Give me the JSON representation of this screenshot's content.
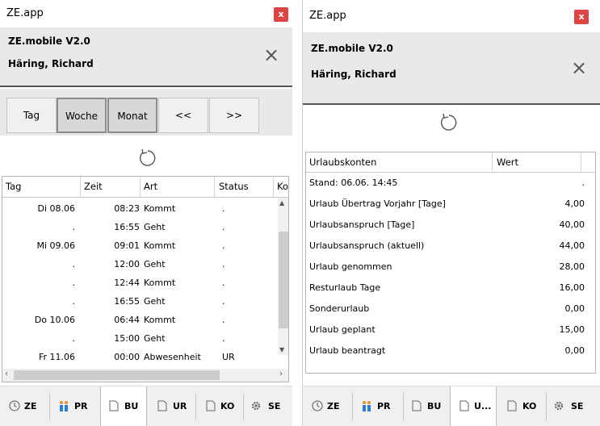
{
  "left": {
    "window_title": "ZE.app",
    "close_label": "x",
    "app_name": "ZE.mobile V2.0",
    "user_name": "Häring, Richard",
    "header_close": "×",
    "toolbar": [
      {
        "label": "Tag",
        "active": false
      },
      {
        "label": "Woche",
        "active": true
      },
      {
        "label": "Monat",
        "active": true
      },
      {
        "label": "<<",
        "active": false
      },
      {
        "label": ">>",
        "active": false
      }
    ],
    "grid": {
      "columns": [
        "Tag",
        "Zeit",
        "Art",
        "Status",
        "Ko"
      ],
      "rows": [
        {
          "tag": "Di 08.06",
          "zeit": "08:23",
          "art": "Kommt",
          "status": "."
        },
        {
          "tag": ".",
          "zeit": "16:55",
          "art": "Geht",
          "status": "."
        },
        {
          "tag": "Mi 09.06",
          "zeit": "09:01",
          "art": "Kommt",
          "status": "."
        },
        {
          "tag": ".",
          "zeit": "12:00",
          "art": "Geht",
          "status": "."
        },
        {
          "tag": ".",
          "zeit": "12:44",
          "art": "Kommt",
          "status": "."
        },
        {
          "tag": ".",
          "zeit": "16:55",
          "art": "Geht",
          "status": "."
        },
        {
          "tag": "Do 10.06",
          "zeit": "06:44",
          "art": "Kommt",
          "status": "."
        },
        {
          "tag": ".",
          "zeit": "15:00",
          "art": "Geht",
          "status": "."
        },
        {
          "tag": "Fr 11.06",
          "zeit": "00:00",
          "art": "Abwesenheit",
          "status": "UR"
        }
      ]
    },
    "nav": [
      {
        "label": "ZE",
        "icon": "clock-icon",
        "active": false
      },
      {
        "label": "PR",
        "icon": "people-icon",
        "active": false
      },
      {
        "label": "BU",
        "icon": "document-icon",
        "active": true
      },
      {
        "label": "UR",
        "icon": "document-icon",
        "active": false
      },
      {
        "label": "KO",
        "icon": "document-icon",
        "active": false
      },
      {
        "label": "SE",
        "icon": "gear-icon",
        "active": false
      }
    ]
  },
  "right": {
    "window_title": "ZE.app",
    "close_label": "x",
    "app_name": "ZE.mobile V2.0",
    "user_name": "Häring, Richard",
    "header_close": "×",
    "table": {
      "columns": [
        "Urlaubskonten",
        "Wert"
      ],
      "rows": [
        {
          "label": "Stand: 06.06. 14:45",
          "value": "."
        },
        {
          "label": "Urlaub Übertrag Vorjahr [Tage]",
          "value": "4,00"
        },
        {
          "label": "Urlaubsanspruch [Tage]",
          "value": "40,00"
        },
        {
          "label": "Urlaubsanspruch (aktuell)",
          "value": "44,00"
        },
        {
          "label": "Urlaub genommen",
          "value": "28,00"
        },
        {
          "label": "Resturlaub Tage",
          "value": "16,00"
        },
        {
          "label": "Sonderurlaub",
          "value": "0,00"
        },
        {
          "label": "Urlaub geplant",
          "value": "15,00"
        },
        {
          "label": "Urlaub beantragt",
          "value": "0,00"
        }
      ]
    },
    "nav": [
      {
        "label": "ZE",
        "icon": "clock-icon",
        "active": false
      },
      {
        "label": "PR",
        "icon": "people-icon",
        "active": false
      },
      {
        "label": "BU",
        "icon": "document-icon",
        "active": false
      },
      {
        "label": "U...",
        "icon": "document-icon",
        "active": true
      },
      {
        "label": "KO",
        "icon": "document-icon",
        "active": false
      },
      {
        "label": "SE",
        "icon": "gear-icon",
        "active": false
      }
    ]
  },
  "colors": {
    "close_red": "#e04343",
    "header_bg": "#e9e9e9",
    "nav_bg": "#f0f0f0"
  }
}
